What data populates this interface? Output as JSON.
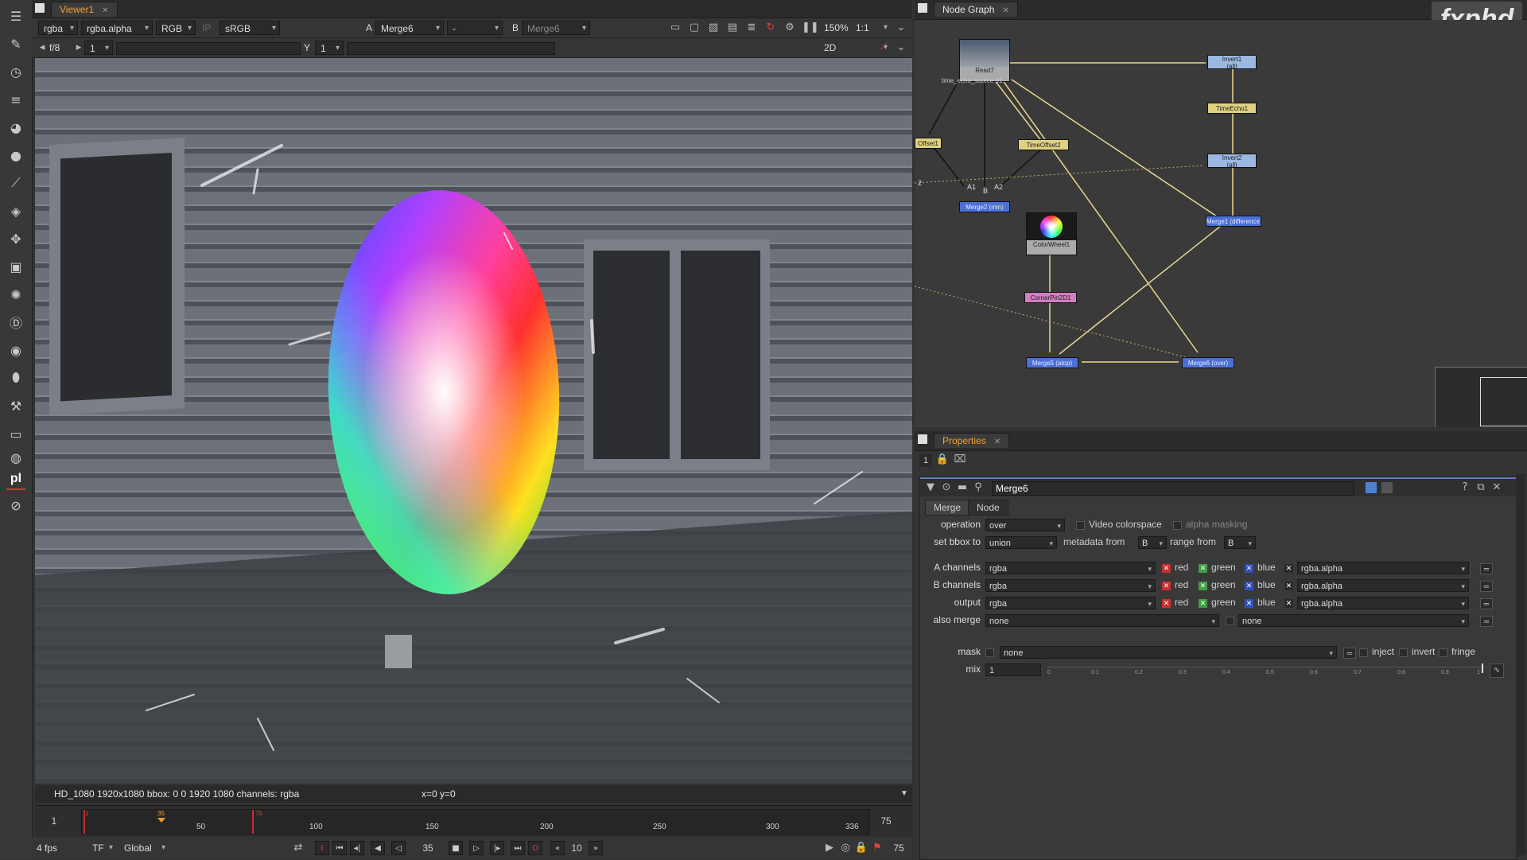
{
  "viewer": {
    "tab_title": "Viewer1",
    "channels": "rgba",
    "alpha_channel": "rgba.alpha",
    "display": "RGB",
    "ip_label": "IP",
    "lut": "sRGB",
    "input_a_label": "A",
    "input_a": "Merge6",
    "wipe": "-",
    "input_b_label": "B",
    "input_b": "Merge6",
    "zoom": "150%",
    "proxy_ratio": "1:1",
    "fstop": "f/8",
    "gain_value": "1",
    "gamma_label": "Y",
    "gamma_value": "1",
    "view_mode": "2D",
    "info_text": "HD_1080 1920x1080  bbox: 0 0 1920 1080 channels: rgba",
    "coords_text": "x=0 y=0"
  },
  "timeline": {
    "in_frame": "1",
    "out_frame": "75",
    "current_frame": "35",
    "ticks": [
      "50",
      "100",
      "150",
      "200",
      "250",
      "300",
      "336"
    ],
    "in_marker": "1",
    "cur_marker": "35",
    "out_marker": "75"
  },
  "playback": {
    "fps": "4 fps",
    "tf": "TF",
    "scope": "Global",
    "frame": "35",
    "increment": "10",
    "end_frame": "75"
  },
  "node_graph": {
    "tab_title": "Node Graph",
    "logo": "fxphd",
    "nodes": {
      "read": "Read7",
      "read_sub": "time_echo_source 01",
      "invert1": "Invert1",
      "invert1_sub": "(all)",
      "timeecho": "TimeEcho1",
      "invert2": "Invert2",
      "invert2_sub": "(all)",
      "offset": "Offset1",
      "timeoffset": "TimeOffset2",
      "merge2": "Merge2 (min)",
      "merge_diff": "Merge1 (difference)",
      "colorwheel": "ColorWheel1",
      "cornerpin": "CornerPin2D1",
      "merge5": "Merge5 (atop)",
      "merge6": "Merge6 (over)"
    },
    "input_labels": {
      "a1": "A1",
      "b": "B",
      "a2": "A2",
      "two": "2"
    }
  },
  "properties": {
    "tab_title": "Properties",
    "count": "1",
    "node_name": "Merge6",
    "tabs": [
      "Merge",
      "Node"
    ],
    "operation_label": "operation",
    "operation": "over",
    "video_colorspace": "Video colorspace",
    "alpha_masking": "alpha masking",
    "bbox_label": "set bbox to",
    "bbox": "union",
    "metadata_label": "metadata from",
    "metadata": "B",
    "range_label": "range from",
    "range": "B",
    "a_channels_label": "A channels",
    "b_channels_label": "B channels",
    "output_label": "output",
    "channel_value": "rgba",
    "red": "red",
    "green": "green",
    "blue": "blue",
    "alpha_value": "rgba.alpha",
    "also_merge_label": "also merge",
    "also_merge": "none",
    "also_merge2": "none",
    "mask_label": "mask",
    "mask": "none",
    "inject": "inject",
    "invert": "invert",
    "fringe": "fringe",
    "mix_label": "mix",
    "mix": "1",
    "mix_ticks": [
      "0",
      "0.1",
      "0.2",
      "0.3",
      "0.4",
      "0.5",
      "0.6",
      "0.7",
      "0.8",
      "0.9",
      "1"
    ]
  }
}
